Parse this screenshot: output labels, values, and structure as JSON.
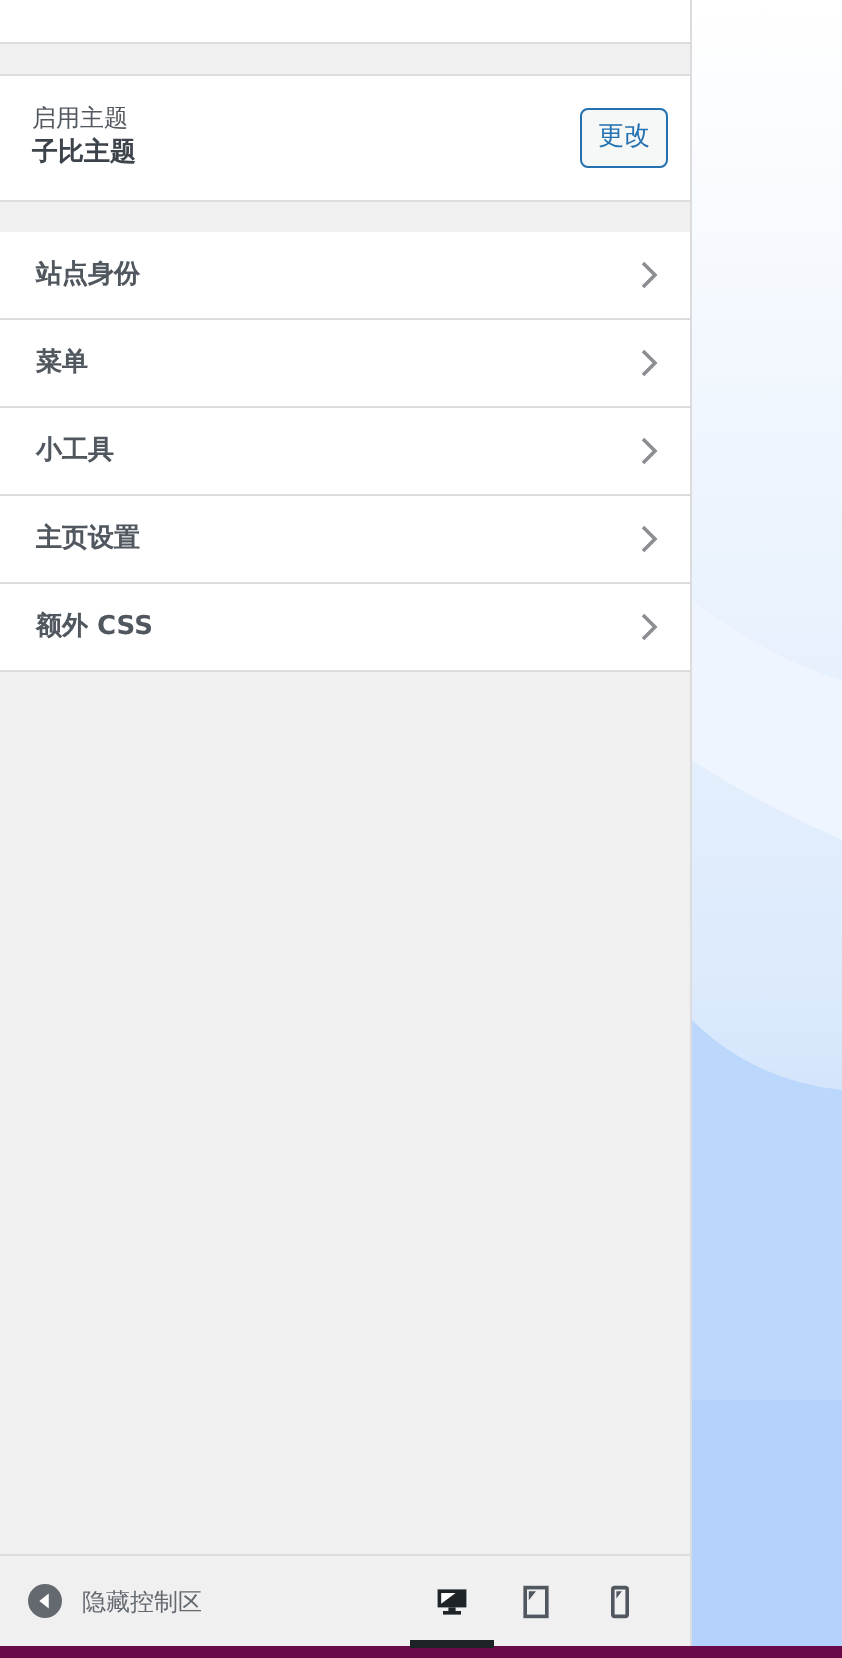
{
  "theme": {
    "label": "启用主题",
    "name": "子比主题",
    "button": "更改"
  },
  "sections": [
    {
      "label": "站点身份"
    },
    {
      "label": "菜单"
    },
    {
      "label": "小工具"
    },
    {
      "label": "主页设置"
    },
    {
      "label": "额外 CSS"
    }
  ],
  "footer": {
    "collapse": "隐藏控制区",
    "devices": [
      {
        "kind": "desktop",
        "selected": true
      },
      {
        "kind": "tablet",
        "selected": false
      },
      {
        "kind": "mobile",
        "selected": false
      }
    ]
  }
}
